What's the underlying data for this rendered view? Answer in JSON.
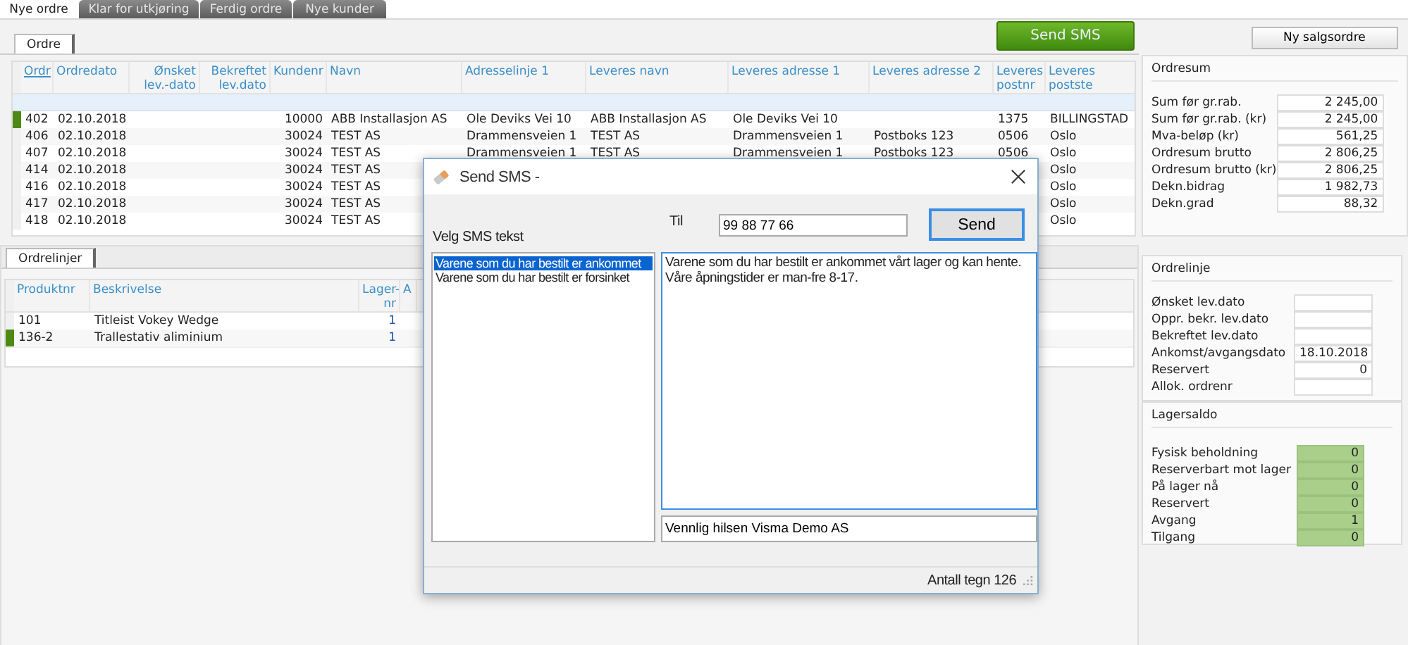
{
  "top_tabs": [
    {
      "label": "Nye ordre",
      "selected": true
    },
    {
      "label": "Klar for utkjøring",
      "selected": false
    },
    {
      "label": "Ferdig ordre",
      "selected": false
    },
    {
      "label": "Nye kunder",
      "selected": false
    }
  ],
  "orders_tab": {
    "label": "Ordre",
    "selected": true
  },
  "send_sms_button": "Send SMS",
  "new_order_button": "Ny salgsordre",
  "orders_table": {
    "columns": [
      {
        "label": "Ordr",
        "sorted": true
      },
      {
        "label": "Ordredato"
      },
      {
        "label": "Ønsket lev.-dato"
      },
      {
        "label": "Bekreftet lev.dato"
      },
      {
        "label": "Kundenr"
      },
      {
        "label": "Navn"
      },
      {
        "label": "Adresselinje 1"
      },
      {
        "label": "Leveres navn"
      },
      {
        "label": "Leveres adresse 1"
      },
      {
        "label": "Leveres adresse 2"
      },
      {
        "label": "Leveres postnr"
      },
      {
        "label": "Leveres postste"
      }
    ],
    "rows": [
      {
        "selected": true,
        "cells": [
          "402",
          "02.10.2018",
          "",
          "",
          "10000",
          "ABB Installasjon AS",
          "Ole Deviks Vei 10",
          "ABB Installasjon AS",
          "Ole Deviks Vei 10",
          "",
          "1375",
          "BILLINGSTAD"
        ]
      },
      {
        "selected": false,
        "cells": [
          "406",
          "02.10.2018",
          "",
          "",
          "30024",
          "TEST AS",
          "Drammensveien 1",
          "TEST AS",
          "Drammensveien 1",
          "Postboks 123",
          "0506",
          "Oslo"
        ]
      },
      {
        "selected": false,
        "cells": [
          "407",
          "02.10.2018",
          "",
          "",
          "30024",
          "TEST AS",
          "Drammensveien 1",
          "TEST AS",
          "Drammensveien 1",
          "Postboks 123",
          "0506",
          "Oslo"
        ]
      },
      {
        "selected": false,
        "cells": [
          "414",
          "02.10.2018",
          "",
          "",
          "30024",
          "TEST AS",
          "",
          "",
          "",
          "",
          "",
          "Oslo"
        ]
      },
      {
        "selected": false,
        "cells": [
          "416",
          "02.10.2018",
          "",
          "",
          "30024",
          "TEST AS",
          "",
          "",
          "",
          "",
          "",
          "Oslo"
        ]
      },
      {
        "selected": false,
        "cells": [
          "417",
          "02.10.2018",
          "",
          "",
          "30024",
          "TEST AS",
          "",
          "",
          "",
          "",
          "",
          "Oslo"
        ]
      },
      {
        "selected": false,
        "cells": [
          "418",
          "02.10.2018",
          "",
          "",
          "30024",
          "TEST AS",
          "",
          "",
          "",
          "",
          "",
          "Oslo"
        ]
      }
    ]
  },
  "ordresum": {
    "title": "Ordresum",
    "fields": [
      {
        "label": "Sum før gr.rab.",
        "value": "2 245,00"
      },
      {
        "label": "Sum før gr.rab. (kr)",
        "value": "2 245,00"
      },
      {
        "label": "Mva-beløp (kr)",
        "value": "561,25"
      },
      {
        "label": "Ordresum brutto",
        "value": "2 806,25"
      },
      {
        "label": "Ordresum brutto (kr)",
        "value": "2 806,25"
      },
      {
        "label": "Dekn.bidrag",
        "value": "1 982,73"
      },
      {
        "label": "Dekn.grad",
        "value": "88,32"
      }
    ]
  },
  "lines_tab": {
    "label": "Ordrelinjer",
    "selected": true
  },
  "lines_table": {
    "columns": [
      {
        "label": "Produktnr"
      },
      {
        "label": "Beskrivelse"
      },
      {
        "label": "Lager-nr"
      },
      {
        "label": "A"
      }
    ],
    "rows": [
      {
        "selected": false,
        "cells": [
          "101",
          "Titleist Vokey Wedge",
          "1",
          ""
        ]
      },
      {
        "selected": true,
        "cells": [
          "136-2",
          "Trallestativ aliminium",
          "1",
          ""
        ]
      }
    ]
  },
  "ordrelinje": {
    "title": "Ordrelinje",
    "fields": [
      {
        "label": "Ønsket lev.dato"
      },
      {
        "label": "Oppr. bekr. lev.dato"
      },
      {
        "label": "Bekreftet lev.dato"
      },
      {
        "label": "Ankomst/avgangsdato",
        "value": "18.10.2018"
      },
      {
        "label": "Reservert",
        "value": "0"
      },
      {
        "label": "Allok. ordrenr"
      }
    ]
  },
  "lagersaldo": {
    "title": "Lagersaldo",
    "fields": [
      {
        "label": "Fysisk beholdning",
        "value": "0"
      },
      {
        "label": "Reserverbart mot lager",
        "value": "0"
      },
      {
        "label": "På lager nå",
        "value": "0"
      },
      {
        "label": "Reservert",
        "value": "0"
      },
      {
        "label": "Avgang",
        "value": "1"
      },
      {
        "label": "Tilgang",
        "value": "0"
      }
    ]
  },
  "dialog": {
    "title": "Send SMS -",
    "to_label": "Til",
    "to_value": "99 88 77 66",
    "send_button": "Send",
    "list_label": "Velg SMS tekst",
    "templates": [
      {
        "label": "Varene som du har bestilt er ankommet",
        "selected": true
      },
      {
        "label": "Varene som du har bestilt er forsinket",
        "selected": false
      }
    ],
    "message_lines": [
      "Varene som du har bestilt er ankommet vårt lager og kan hente.",
      "Våre åpningstider er man-fre 8-17."
    ],
    "signature": "Vennlig hilsen Visma Demo AS",
    "char_count": "Antall tegn 126"
  }
}
